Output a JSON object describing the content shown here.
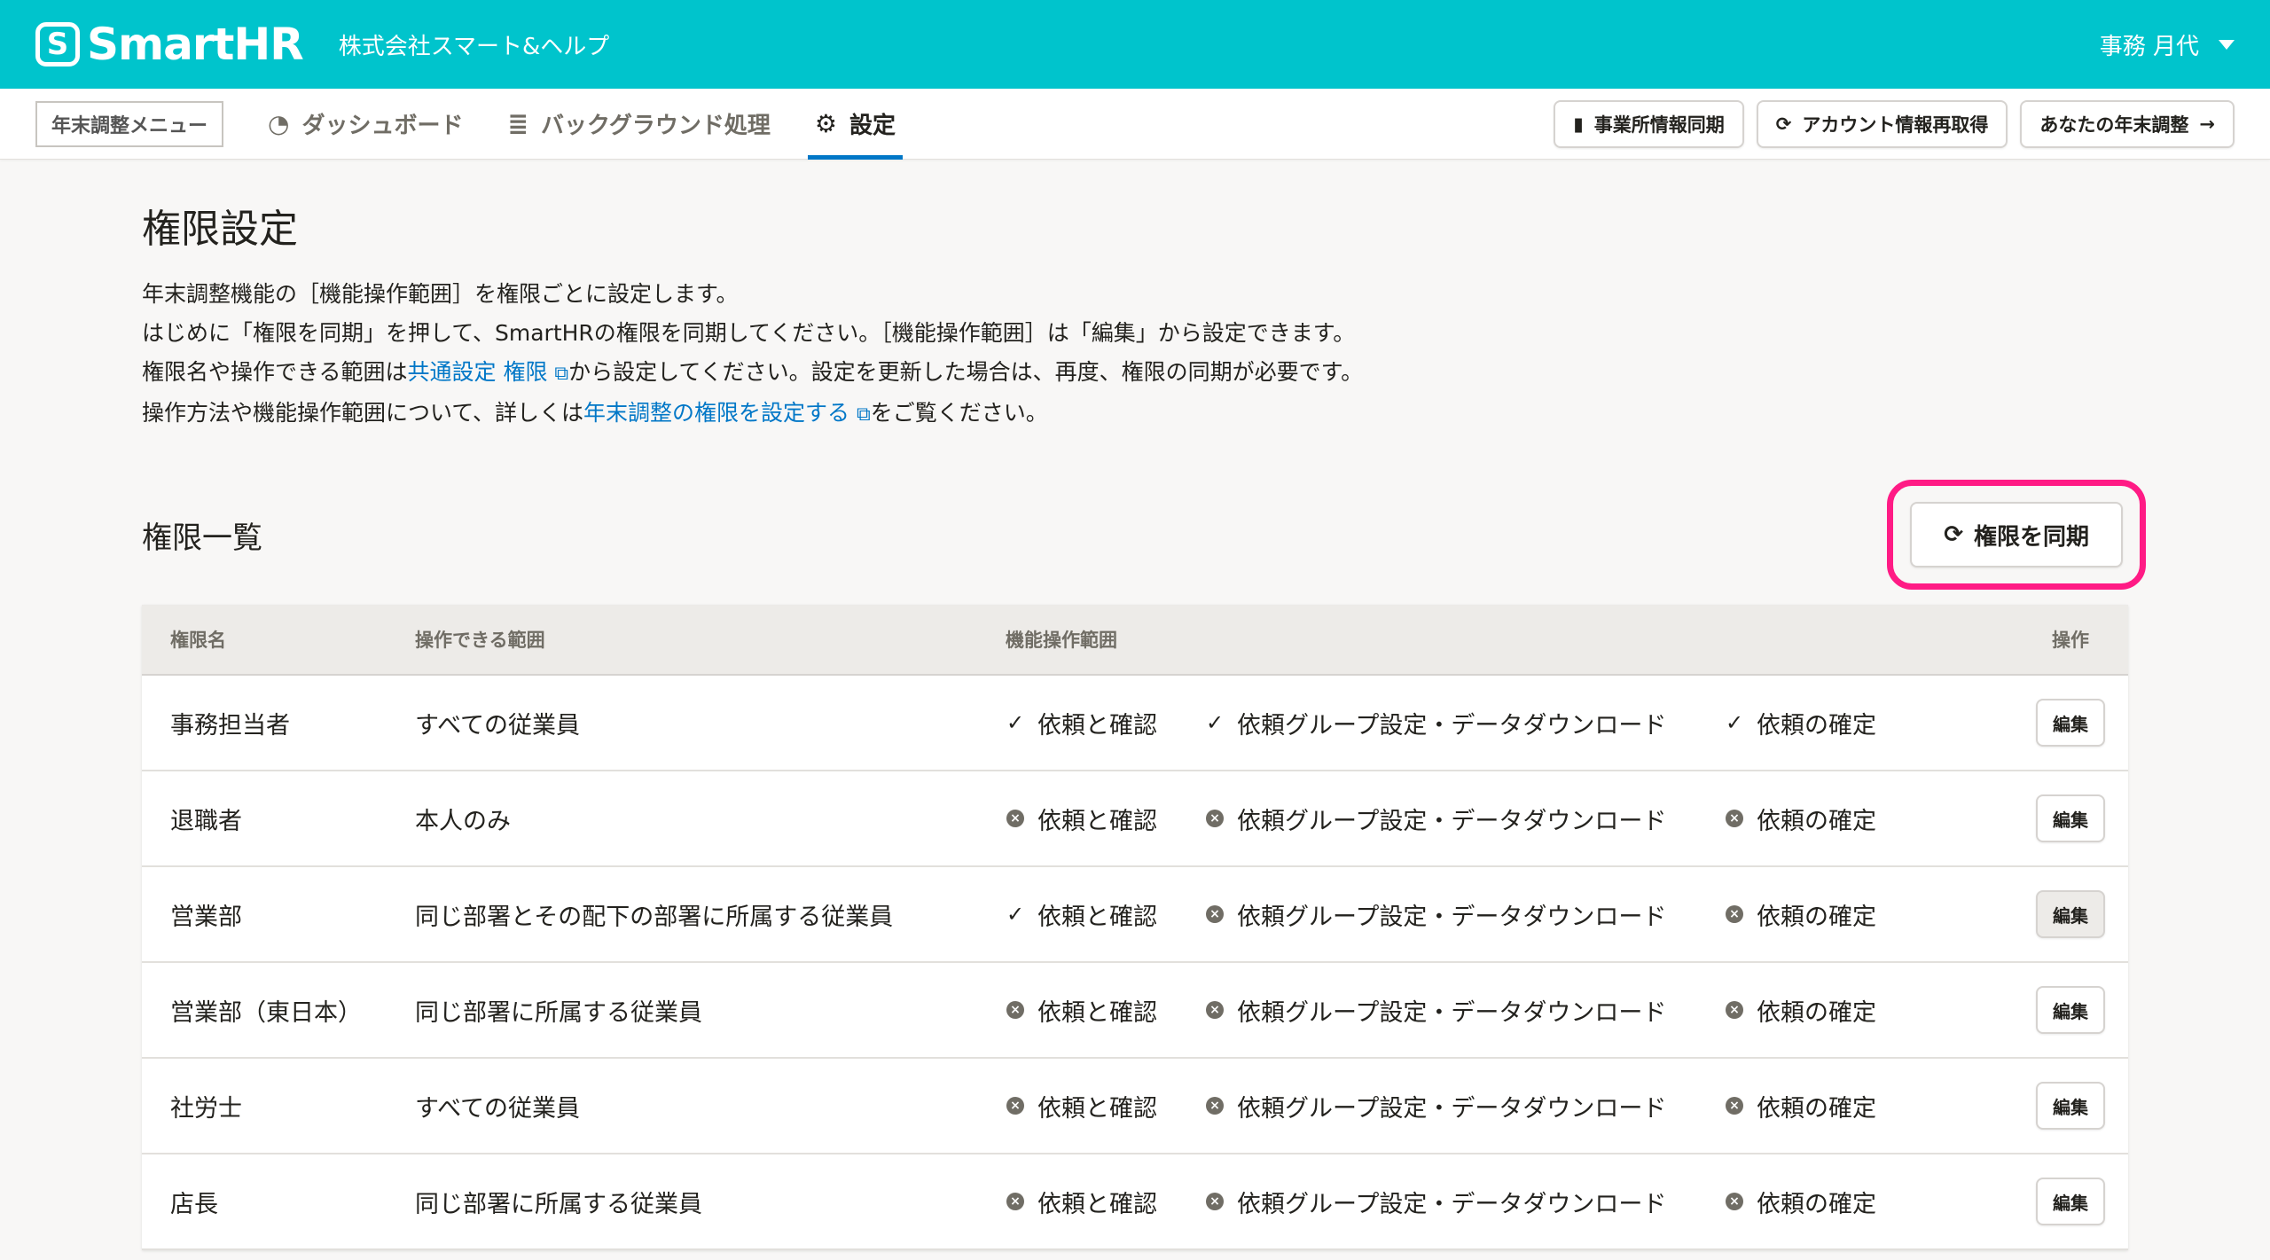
{
  "header": {
    "logo_mark": "S",
    "logo_text": "SmartHR",
    "company": "株式会社スマート&ヘルプ",
    "user": "事務 月代"
  },
  "nav": {
    "menu_label": "年末調整メニュー",
    "items": [
      {
        "label": "ダッシュボード",
        "icon": "gauge-icon"
      },
      {
        "label": "バックグラウンド処理",
        "icon": "database-icon"
      },
      {
        "label": "設定",
        "icon": "gear-icon",
        "active": true
      }
    ],
    "actions": {
      "sync_office": "事業所情報同期",
      "refetch_account": "アカウント情報再取得",
      "your_adjustment": "あなたの年末調整"
    }
  },
  "page": {
    "title": "権限設定",
    "desc": {
      "line1": "年末調整機能の［機能操作範囲］を権限ごとに設定します。",
      "line2": "はじめに「権限を同期」を押して、SmartHRの権限を同期してください。［機能操作範囲］は「編集」から設定できます。",
      "line3_pre": "権限名や操作できる範囲は",
      "line3_link": "共通設定 権限",
      "line3_post": "から設定してください。設定を更新した場合は、再度、権限の同期が必要です。",
      "line4_pre": "操作方法や機能操作範囲について、詳しくは",
      "line4_link": "年末調整の権限を設定する",
      "line4_post": "をご覧ください。"
    },
    "section_title": "権限一覧",
    "sync_button": "権限を同期"
  },
  "table": {
    "headers": {
      "name": "権限名",
      "scope": "操作できる範囲",
      "func": "機能操作範囲",
      "op": "操作"
    },
    "func_labels": [
      "依頼と確認",
      "依頼グループ設定・データダウンロード",
      "依頼の確定"
    ],
    "edit_label": "編集",
    "rows": [
      {
        "name": "事務担当者",
        "scope": "すべての従業員",
        "perms": [
          true,
          true,
          true
        ]
      },
      {
        "name": "退職者",
        "scope": "本人のみ",
        "perms": [
          false,
          false,
          false
        ]
      },
      {
        "name": "営業部",
        "scope": "同じ部署とその配下の部署に所属する従業員",
        "perms": [
          true,
          false,
          false
        ]
      },
      {
        "name": "営業部（東日本）",
        "scope": "同じ部署に所属する従業員",
        "perms": [
          false,
          false,
          false
        ]
      },
      {
        "name": "社労士",
        "scope": "すべての従業員",
        "perms": [
          false,
          false,
          false
        ]
      },
      {
        "name": "店長",
        "scope": "同じ部署に所属する従業員",
        "perms": [
          false,
          false,
          false
        ]
      }
    ]
  }
}
